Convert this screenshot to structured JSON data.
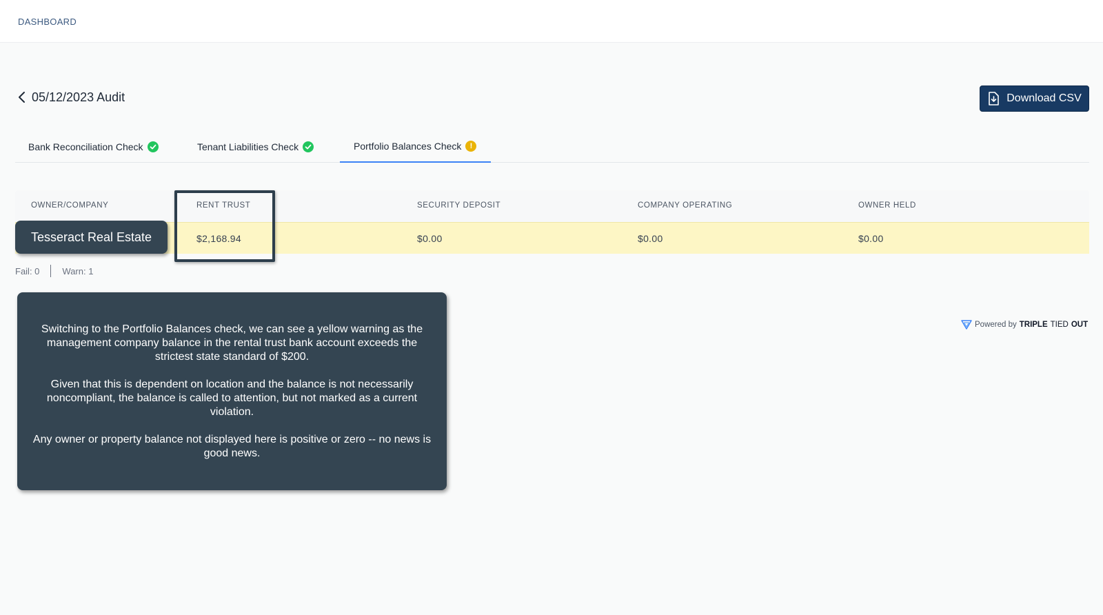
{
  "header": {
    "breadcrumb": "DASHBOARD"
  },
  "page": {
    "title": "05/12/2023 Audit",
    "download_label": "Download CSV"
  },
  "tabs": [
    {
      "label": "Bank Reconciliation Check",
      "status": "pass"
    },
    {
      "label": "Tenant Liabilities Check",
      "status": "pass"
    },
    {
      "label": "Portfolio Balances Check",
      "status": "warn",
      "warn_glyph": "!"
    }
  ],
  "table": {
    "columns": [
      "OWNER/COMPANY",
      "RENT TRUST",
      "SECURITY DEPOSIT",
      "COMPANY OPERATING",
      "OWNER HELD"
    ],
    "rows": [
      {
        "owner": "Tesseract Real Estate",
        "rent_trust": "$2,168.94",
        "security_deposit": "$0.00",
        "company_operating": "$0.00",
        "owner_held": "$0.00"
      }
    ]
  },
  "counts": {
    "fail": "Fail: 0",
    "warn": "Warn: 1"
  },
  "tooltip": {
    "p1": "Switching to the Portfolio Balances check, we can see a yellow warning as the management company balance in the rental trust bank account exceeds the strictest state standard of $200.",
    "p2": "Given that this is dependent on location and the balance is not necessarily noncompliant, the balance is called to attention, but not marked as a current violation.",
    "p3": "Any owner or property balance not displayed here is positive or zero -- no news is good news."
  },
  "footer": {
    "powered_by": "Powered by",
    "brand_1": "TRIPLE",
    "brand_2": "TIED",
    "brand_3": "OUT"
  },
  "colors": {
    "primary": "#183a63",
    "accent_tab": "#3b82f6",
    "warn_row": "#fdf6c5",
    "ok": "#22c55e",
    "warn": "#eab308",
    "tooltip_bg": "#344552"
  }
}
